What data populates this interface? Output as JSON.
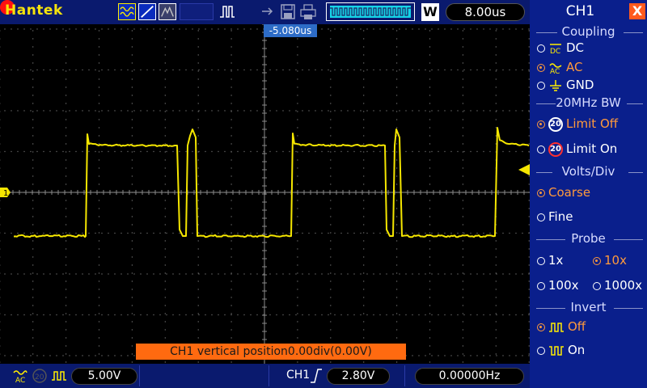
{
  "brand": "Hantek",
  "toolbar": {
    "icons": [
      "waveform-icon",
      "ramp-icon",
      "persistence-icon",
      "pulse-icon",
      "record-icon",
      "import-export-icon",
      "save-icon",
      "print-icon"
    ],
    "mode": "W",
    "timebase": "8.00us"
  },
  "screen": {
    "trigger_position": "-5.080us",
    "channel_marker": "1",
    "vertical_position_message": "CH1 vertical position0.00div(0.00V)"
  },
  "status": {
    "volts_div": "5.00V",
    "trigger_channel": "CH1",
    "trigger_level": "2.80V",
    "frequency": "0.00000Hz"
  },
  "panel": {
    "title": "CH1",
    "close": "X",
    "coupling": {
      "title": "Coupling",
      "options": [
        {
          "icon": "DC",
          "label": "DC",
          "selected": false
        },
        {
          "icon": "AC",
          "label": "AC",
          "selected": true
        },
        {
          "icon": "GND",
          "label": "GND",
          "selected": false
        }
      ]
    },
    "bandwidth": {
      "title": "20MHz BW",
      "options": [
        {
          "icon": "20",
          "label": "Limit Off",
          "selected": true
        },
        {
          "icon": "20",
          "label": "Limit On",
          "selected": false
        }
      ]
    },
    "volts_div": {
      "title": "Volts/Div",
      "options": [
        {
          "label": "Coarse",
          "selected": true
        },
        {
          "label": "Fine",
          "selected": false
        }
      ]
    },
    "probe": {
      "title": "Probe",
      "options": [
        {
          "label": "1x",
          "selected": false
        },
        {
          "label": "10x",
          "selected": true
        },
        {
          "label": "100x",
          "selected": false
        },
        {
          "label": "1000x",
          "selected": false
        }
      ]
    },
    "invert": {
      "title": "Invert",
      "options": [
        {
          "label": "Off",
          "selected": true
        },
        {
          "label": "On",
          "selected": false
        }
      ]
    }
  },
  "colors": {
    "trace": "#f5e600",
    "selected": "#ff9a3c",
    "panel": "#0a1f8c",
    "bar": "#0a1a6e",
    "accent": "#ff6a10"
  }
}
